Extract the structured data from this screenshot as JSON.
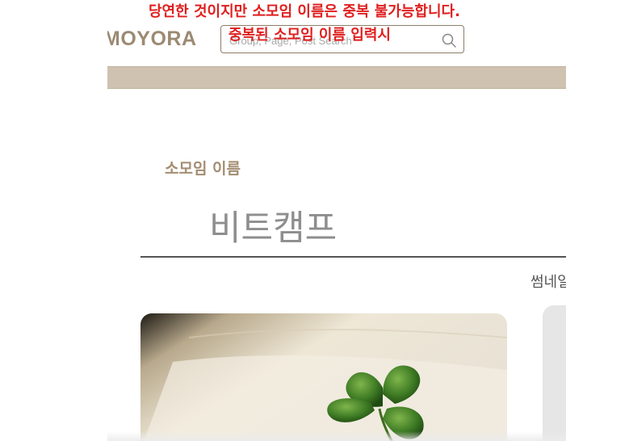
{
  "header": {
    "logo_text": "MOYORA",
    "search_placeholder": "Group, Page, Post Search",
    "search_icon": "search-icon"
  },
  "form": {
    "group_name_label": "소모임 이름",
    "group_name_value": "비트캠프",
    "thumbnail_label": "썸네일"
  },
  "annotations": {
    "line1": "당연한 것이지만 소모임 이름은 중복 불가능합니다.",
    "line2": "중복된 소모임 이름 입력시"
  },
  "colors": {
    "brand": "#9c8a72",
    "nav_bar": "#cfc2b1",
    "annotation_red": "#e01e1e"
  }
}
